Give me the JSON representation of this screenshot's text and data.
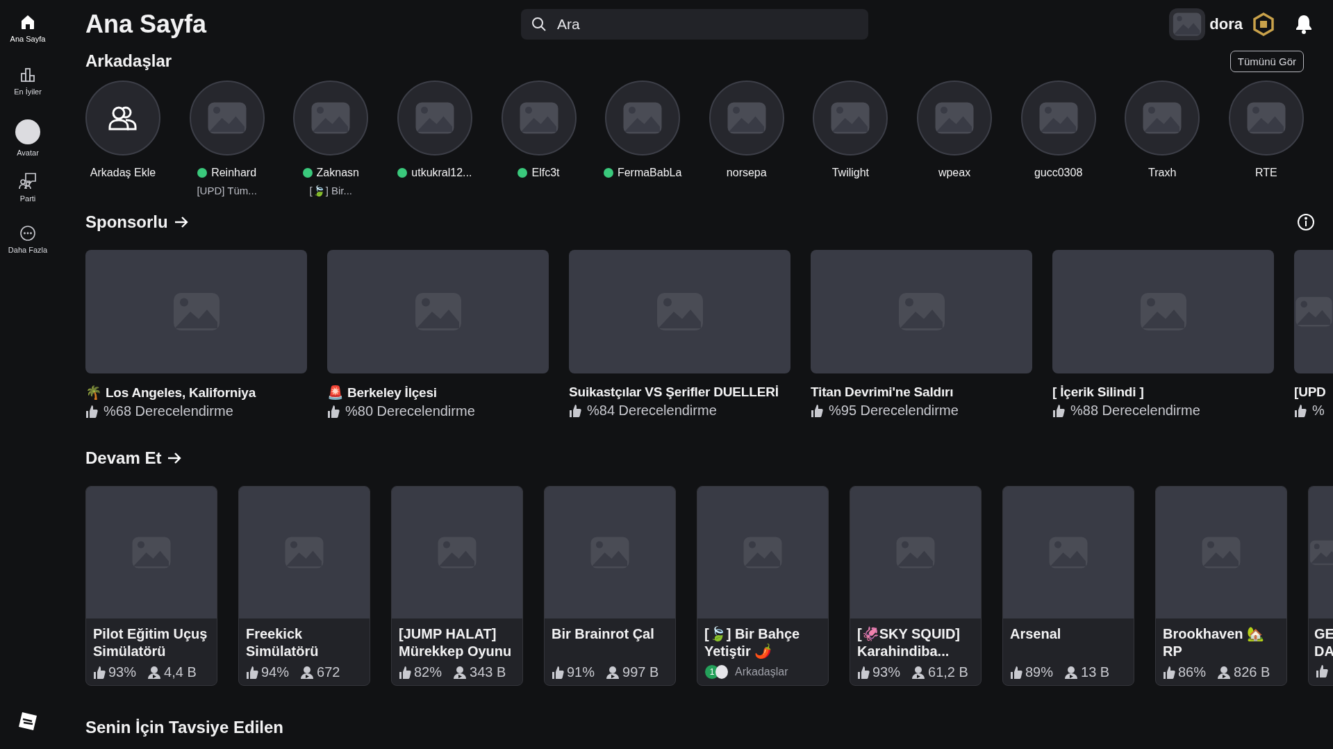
{
  "sidebar": {
    "items": [
      {
        "label": "Ana Sayfa",
        "kind": "home",
        "selected": true
      },
      {
        "label": "En İyiler",
        "kind": "charts",
        "selected": false
      },
      {
        "label": "Avatar",
        "kind": "avatar",
        "selected": false
      },
      {
        "label": "Parti",
        "kind": "party",
        "selected": false
      },
      {
        "label": "Daha Fazla",
        "kind": "more",
        "selected": false
      }
    ]
  },
  "header": {
    "title": "Ana Sayfa",
    "search": {
      "placeholder": "Ara"
    },
    "username": "dora"
  },
  "friends": {
    "title": "Arkadaşlar",
    "see_all": "Tümünü Gör",
    "items": [
      {
        "kind": "add",
        "name": "Arkadaş Ekle",
        "online": false
      },
      {
        "kind": "friend",
        "name": "Reinhard",
        "online": true,
        "status": "[UPD] Tüm..."
      },
      {
        "kind": "friend",
        "name": "Zaknasn",
        "online": true,
        "status": "[🍃] Bir..."
      },
      {
        "kind": "friend",
        "name": "utkukral12...",
        "online": true
      },
      {
        "kind": "friend",
        "name": "Elfc3t",
        "online": true
      },
      {
        "kind": "friend",
        "name": "FermaBabLa",
        "online": true
      },
      {
        "kind": "friend",
        "name": "norsepa",
        "online": false
      },
      {
        "kind": "friend",
        "name": "Twilight",
        "online": false
      },
      {
        "kind": "friend",
        "name": "wpeax",
        "online": false
      },
      {
        "kind": "friend",
        "name": "gucc0308",
        "online": false
      },
      {
        "kind": "friend",
        "name": "Traxh",
        "online": false
      },
      {
        "kind": "friend",
        "name": "RTE",
        "online": false
      }
    ]
  },
  "sponsored": {
    "title": "Sponsorlu",
    "items": [
      {
        "title": "🌴 Los Angeles, Kaliforniya",
        "rating": "%68 Derecelendirme"
      },
      {
        "title": "🚨 Berkeley İlçesi",
        "rating": "%80 Derecelendirme"
      },
      {
        "title": "Suikastçılar VS Şerifler DUELLERİ",
        "rating": "%84 Derecelendirme"
      },
      {
        "title": "Titan Devrimi'ne Saldırı",
        "rating": "%95 Derecelendirme"
      },
      {
        "title": "[ İçerik Silindi ]",
        "rating": "%88 Derecelendirme"
      },
      {
        "title": "[UPD",
        "rating": "%"
      }
    ]
  },
  "continue": {
    "title": "Devam Et",
    "items": [
      {
        "kind": "stats",
        "title": "Pilot Eğitim Uçuş Simülatörü",
        "rating": "93%",
        "players": "4,4 B"
      },
      {
        "kind": "stats",
        "title": "Freekick Simülatörü",
        "rating": "94%",
        "players": "672"
      },
      {
        "kind": "stats",
        "title": "[JUMP HALAT] Mürekkep Oyunu",
        "rating": "82%",
        "players": "343 B"
      },
      {
        "kind": "stats",
        "title": "Bir Brainrot Çal",
        "rating": "91%",
        "players": "997 B"
      },
      {
        "kind": "friends",
        "title": "[🍃] Bir Bahçe Yetiştir 🌶️",
        "friend_count": "1",
        "friends_label": "Arkadaşlar"
      },
      {
        "kind": "stats",
        "title": "[🦑SKY SQUID] Karahindiba...",
        "rating": "93%",
        "players": "61,2 B"
      },
      {
        "kind": "stats",
        "title": "Arsenal",
        "rating": "89%",
        "players": "13 B"
      },
      {
        "kind": "stats",
        "title": "Brookhaven 🏡 RP",
        "rating": "86%",
        "players": "826 B"
      },
      {
        "kind": "partial",
        "title": "GE DA"
      }
    ]
  },
  "recommended": {
    "title": "Senin İçin Tavsiye Edilen"
  }
}
